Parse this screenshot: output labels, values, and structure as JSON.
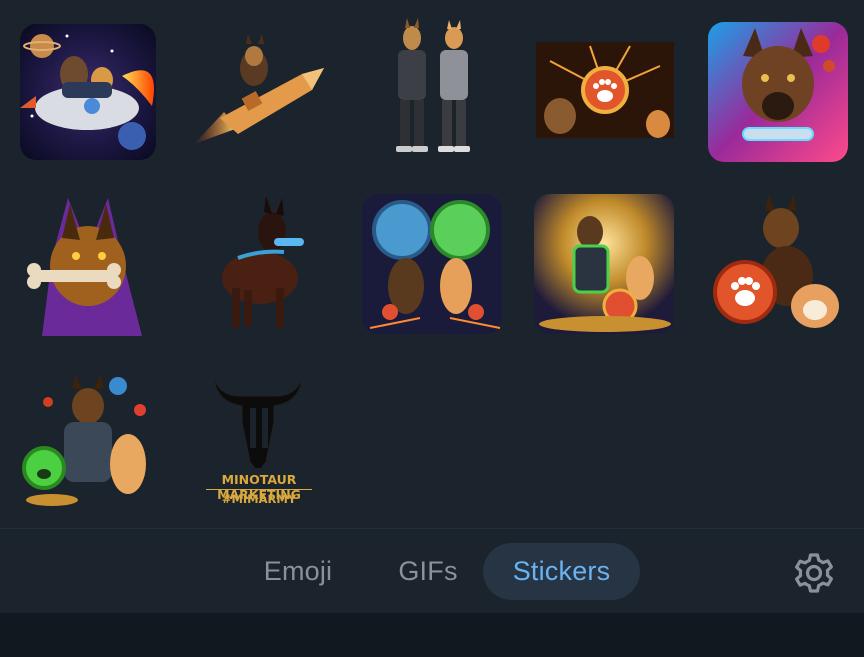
{
  "stickers": [
    {
      "name": "astronaut dogs riding a rocket in space"
    },
    {
      "name": "german shepherd riding a rocket"
    },
    {
      "name": "two dog-headed figures in hoodies"
    },
    {
      "name": "dogs with red paw coin and fireworks"
    },
    {
      "name": "neon german shepherd with bone"
    },
    {
      "name": "purple wolf dog biting a bone"
    },
    {
      "name": "doberman with blue bone"
    },
    {
      "name": "two dogs with blue and green paw coins"
    },
    {
      "name": "armored shepherd with shiba and coins"
    },
    {
      "name": "shepherd and shiba with red paw coin"
    },
    {
      "name": "armored shepherd with shiba and green paw coin"
    },
    {
      "name": "minotaur marketing logo",
      "line1": "MINOTAUR MARKETING",
      "line2": "#MIMARMY"
    }
  ],
  "tabs": {
    "emoji": "Emoji",
    "gifs": "GIFs",
    "stickers": "Stickers",
    "active": "stickers"
  },
  "colors": {
    "background": "#1b232d",
    "active_tab_bg": "#263443",
    "active_tab_text": "#6ab3f3",
    "inactive_tab_text": "#8a9199",
    "logo_gold": "#d9a93d"
  },
  "icons": {
    "settings": "gear-icon"
  }
}
